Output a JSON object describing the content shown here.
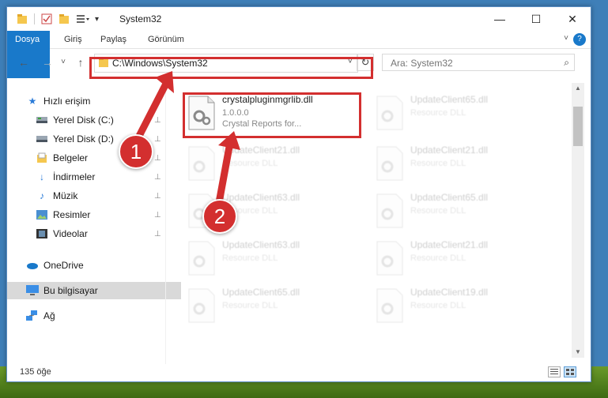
{
  "window": {
    "title": "System32",
    "minimize_glyph": "—",
    "maximize_glyph": "☐",
    "close_glyph": "✕"
  },
  "ribbon": {
    "tabs": [
      "Dosya",
      "Giriş",
      "Paylaş",
      "Görünüm"
    ],
    "help": "?",
    "collapse": "˅"
  },
  "nav": {
    "back": "←",
    "forward": "→",
    "recent": "˅",
    "up": "↑",
    "address": "C:\\Windows\\System32",
    "address_chevron": "˅",
    "refresh": "↻",
    "search_placeholder": "Ara: System32",
    "search_icon_glyph": "⌕"
  },
  "sidebar": {
    "items": [
      {
        "label": "Hızlı erişim",
        "icon": "star-icon"
      },
      {
        "label": "Yerel Disk (C:)",
        "icon": "drive-icon",
        "pinned": true
      },
      {
        "label": "Yerel Disk (D:)",
        "icon": "drive-icon",
        "pinned": true
      },
      {
        "label": "Belgeler",
        "icon": "documents-icon",
        "pinned": true
      },
      {
        "label": "İndirmeler",
        "icon": "download-icon",
        "pinned": true
      },
      {
        "label": "Müzik",
        "icon": "music-icon",
        "pinned": true
      },
      {
        "label": "Resimler",
        "icon": "pictures-icon",
        "pinned": true
      },
      {
        "label": "Videolar",
        "icon": "videos-icon",
        "pinned": true
      },
      {
        "label": "OneDrive",
        "icon": "cloud-icon"
      },
      {
        "label": "Bu bilgisayar",
        "icon": "computer-icon",
        "selected": true
      },
      {
        "label": "Ağ",
        "icon": "network-icon"
      }
    ],
    "pin_glyph": "📌"
  },
  "files": {
    "highlighted": {
      "name": "crystalpluginmgrlib.dll",
      "version": "1.0.0.0",
      "description": "Crystal Reports for..."
    },
    "faded": [
      {
        "name": "UpdateClient65.dll",
        "desc": "Resource DLL"
      },
      {
        "name": "UpdateClient21.dll",
        "desc": "Resource DLL"
      },
      {
        "name": "UpdateClient21.dll",
        "desc": "Resource DLL"
      },
      {
        "name": "UpdateClient63.dll",
        "desc": "Resource DLL"
      },
      {
        "name": "UpdateClient65.dll",
        "desc": "Resource DLL"
      },
      {
        "name": "UpdateClient63.dll",
        "desc": "Resource DLL"
      },
      {
        "name": "UpdateClient21.dll",
        "desc": "Resource DLL"
      },
      {
        "name": "UpdateClient65.dll",
        "desc": "Resource DLL"
      },
      {
        "name": "UpdateClient19.dll",
        "desc": "Resource DLL"
      }
    ]
  },
  "status": {
    "count": "135 öğe"
  },
  "annotations": {
    "step1": "1",
    "step2": "2",
    "color": "#d32f2f"
  }
}
